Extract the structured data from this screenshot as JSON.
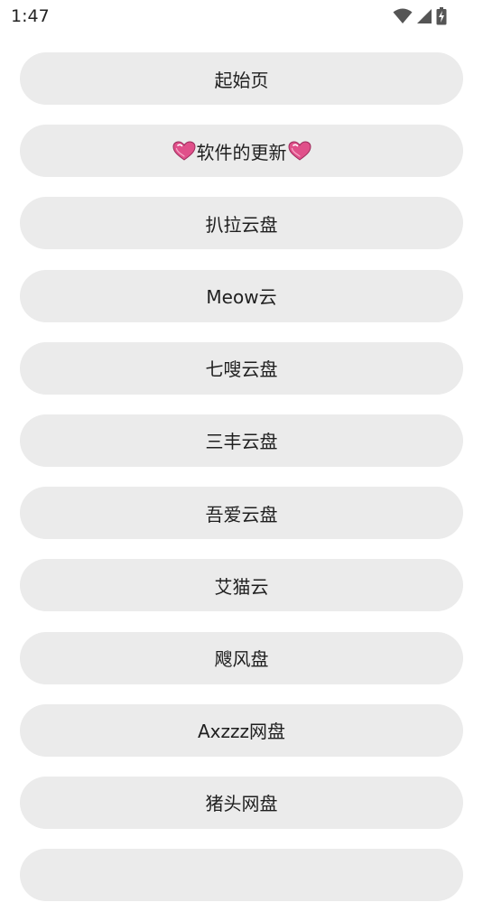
{
  "status_bar": {
    "time": "1:47",
    "icons": [
      "wifi-icon",
      "signal-icon",
      "battery-charging-icon"
    ]
  },
  "menu": {
    "items": [
      {
        "label": "起始页"
      },
      {
        "label": "软件的更新",
        "decoration": "heart-icon"
      },
      {
        "label": "扒拉云盘"
      },
      {
        "label": "Meow云"
      },
      {
        "label": "七嗖云盘"
      },
      {
        "label": "三丰云盘"
      },
      {
        "label": "吾爱云盘"
      },
      {
        "label": "艾猫云"
      },
      {
        "label": "飕风盘"
      },
      {
        "label": "Axzzz网盘"
      },
      {
        "label": "猪头网盘"
      }
    ]
  },
  "colors": {
    "item_background": "#ebebeb",
    "text": "#1f1f1f",
    "heart": "#e0508a"
  }
}
